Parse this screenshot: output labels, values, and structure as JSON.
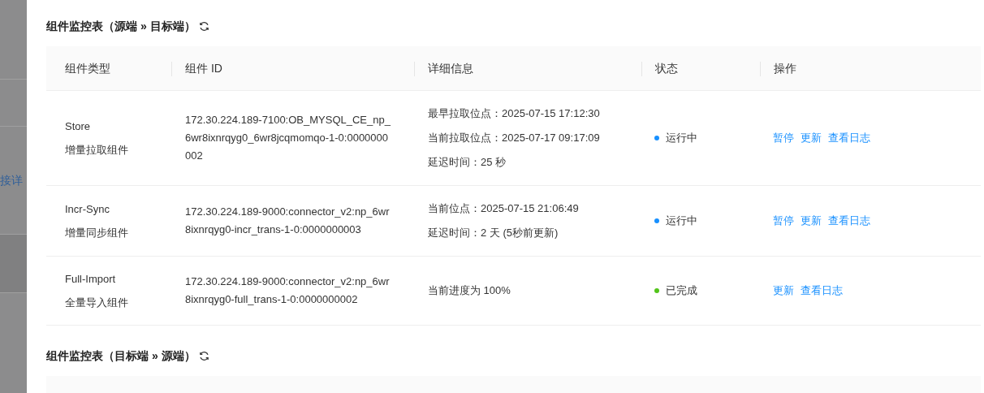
{
  "background": {
    "fragments": [
      "接详"
    ]
  },
  "sections": [
    {
      "title": "组件监控表（源端 » 目标端）",
      "columns": [
        "组件类型",
        "组件 ID",
        "详细信息",
        "状态",
        "操作"
      ],
      "rows": [
        {
          "type": "Store",
          "type_label": "增量拉取组件",
          "id": "172.30.224.189-7100:OB_MYSQL_CE_np_6wr8ixnrqyg0_6wr8jcqmomqo-1-0:0000000002",
          "details": [
            "最早拉取位点：2025-07-15 17:12:30",
            "当前拉取位点：2025-07-17 09:17:09",
            "延迟时间：25 秒"
          ],
          "status": "运行中",
          "color": "#1890ff",
          "actions": [
            "暂停",
            "更新",
            "查看日志"
          ]
        },
        {
          "type": "Incr-Sync",
          "type_label": "增量同步组件",
          "id": "172.30.224.189-9000:connector_v2:np_6wr8ixnrqyg0-incr_trans-1-0:0000000003",
          "details": [
            "当前位点：2025-07-15 21:06:49",
            "延迟时间：2 天 (5秒前更新)"
          ],
          "status": "运行中",
          "color": "#1890ff",
          "actions": [
            "暂停",
            "更新",
            "查看日志"
          ]
        },
        {
          "type": "Full-Import",
          "type_label": "全量导入组件",
          "id": "172.30.224.189-9000:connector_v2:np_6wr8ixnrqyg0-full_trans-1-0:0000000002",
          "details": [
            "当前进度为 100%"
          ],
          "status": "已完成",
          "color": "#52c41a",
          "actions": [
            "更新",
            "查看日志"
          ]
        }
      ]
    },
    {
      "title": "组件监控表（目标端 » 源端）"
    }
  ]
}
